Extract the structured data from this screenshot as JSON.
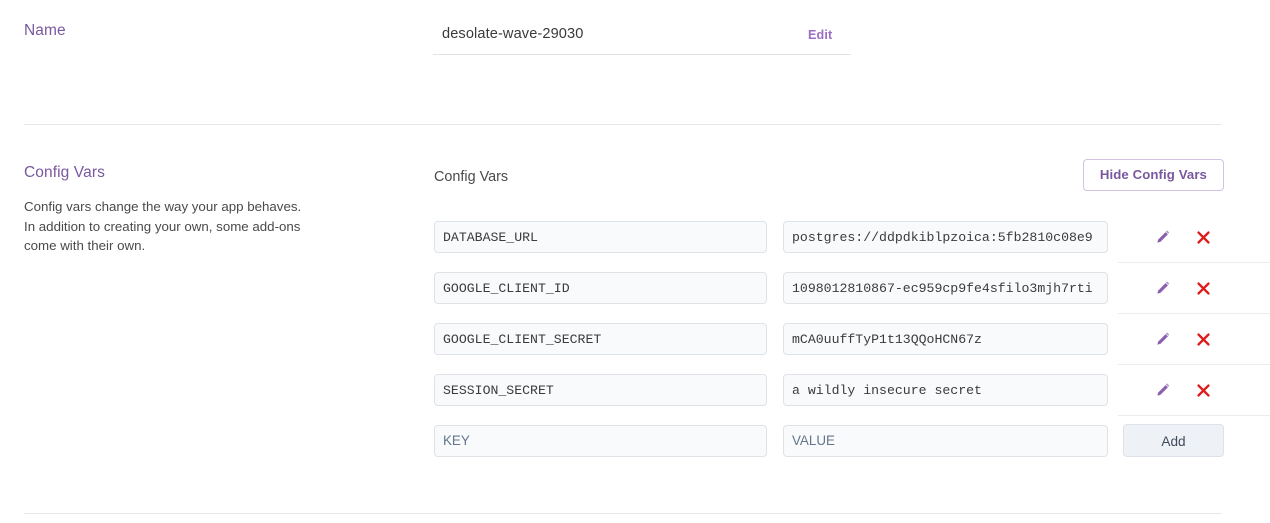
{
  "name_section": {
    "side_title": "Name",
    "value": "desolate-wave-29030",
    "edit_label": "Edit"
  },
  "config_section": {
    "side_title": "Config Vars",
    "side_description": "Config vars change the way your app behaves. In addition to creating your own, some add-ons come with their own.",
    "main_label": "Config Vars",
    "hide_button_label": "Hide Config Vars",
    "rows": [
      {
        "key": "DATABASE_URL",
        "value": "postgres://ddpdkiblpzoica:5fb2810c08e9"
      },
      {
        "key": "GOOGLE_CLIENT_ID",
        "value": "1098012810867-ec959cp9fe4sfilo3mjh7rti"
      },
      {
        "key": "GOOGLE_CLIENT_SECRET",
        "value": "mCA0uuffTyP1t13QQoHCN67z"
      },
      {
        "key": "SESSION_SECRET",
        "value": "a wildly insecure secret"
      }
    ],
    "new_row": {
      "key_placeholder": "KEY",
      "value_placeholder": "VALUE",
      "add_label": "Add"
    },
    "icons": {
      "edit": "pencil-icon",
      "delete": "close-icon"
    }
  },
  "colors": {
    "accent_purple": "#79589f",
    "link_purple": "#9b6fc4",
    "pencil_purple": "#8a5fb0",
    "delete_red": "#dd1c1c",
    "divider": "#e7e7e9"
  }
}
